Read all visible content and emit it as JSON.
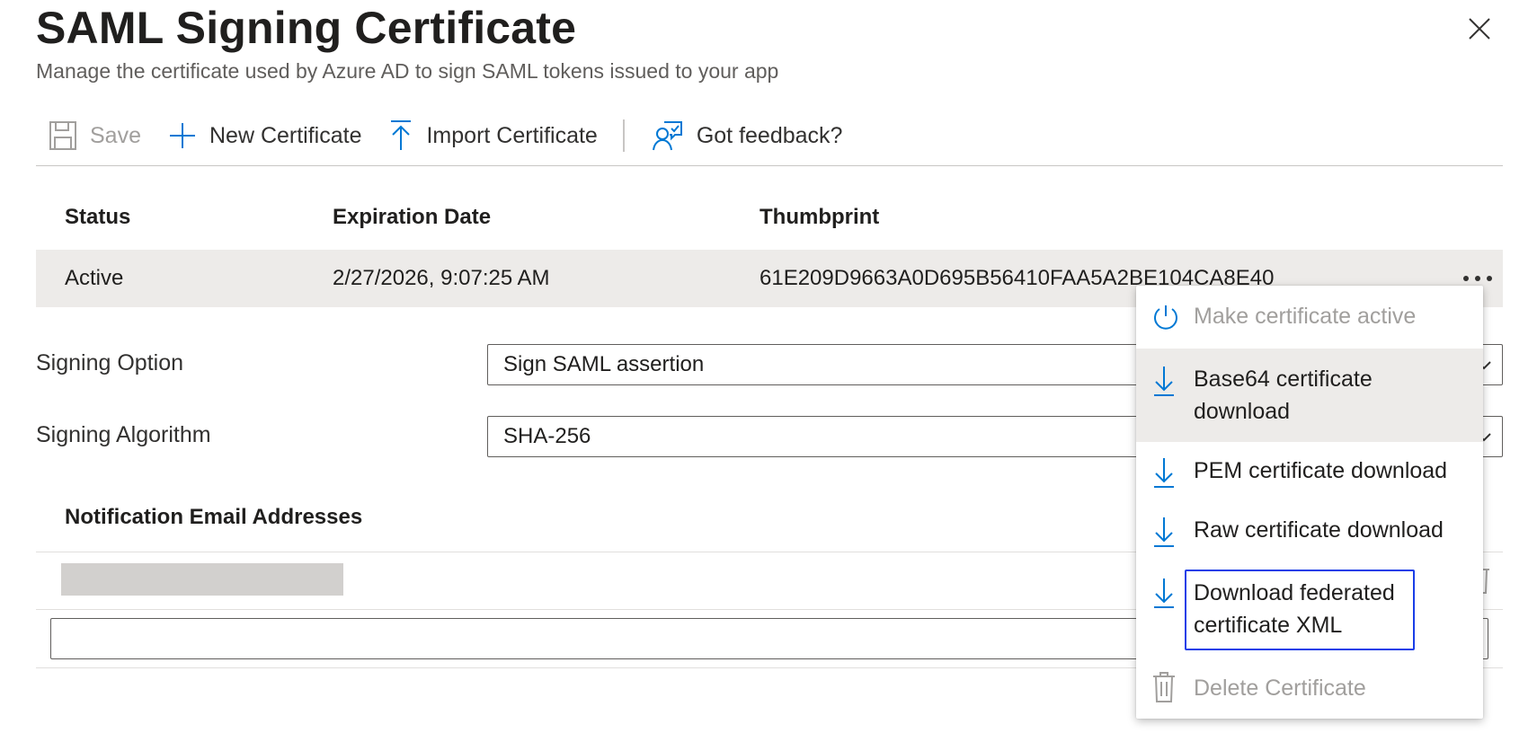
{
  "header": {
    "title": "SAML Signing Certificate",
    "subtitle": "Manage the certificate used by Azure AD to sign SAML tokens issued to your app"
  },
  "toolbar": {
    "save_label": "Save",
    "new_certificate_label": "New Certificate",
    "import_certificate_label": "Import Certificate",
    "feedback_label": "Got feedback?"
  },
  "certificates": {
    "columns": [
      "Status",
      "Expiration Date",
      "Thumbprint"
    ],
    "rows": [
      {
        "status": "Active",
        "expiration": "2/27/2026, 9:07:25 AM",
        "thumbprint": "61E209D9663A0D695B56410FAA5A2BE104CA8E40"
      }
    ]
  },
  "signing": {
    "option_label": "Signing Option",
    "option_value": "Sign SAML assertion",
    "algorithm_label": "Signing Algorithm",
    "algorithm_value": "SHA-256"
  },
  "notifications": {
    "title": "Notification Email Addresses",
    "input_value": ""
  },
  "context_menu": {
    "items": [
      {
        "label": "Make certificate active",
        "icon": "power-icon",
        "disabled": true
      },
      {
        "label": "Base64 certificate download",
        "icon": "download-icon",
        "hovered": true
      },
      {
        "label": "PEM certificate download",
        "icon": "download-icon"
      },
      {
        "label": "Raw certificate download",
        "icon": "download-icon"
      },
      {
        "label": "Download federated certificate XML",
        "icon": "download-icon",
        "focused": true
      },
      {
        "label": "Delete Certificate",
        "icon": "trash-icon",
        "disabled": true
      }
    ]
  },
  "colors": {
    "accent": "#0078d4",
    "focus_outline": "#1a3ee8",
    "row_background": "#edebe9",
    "disabled_text": "#a19f9d"
  }
}
